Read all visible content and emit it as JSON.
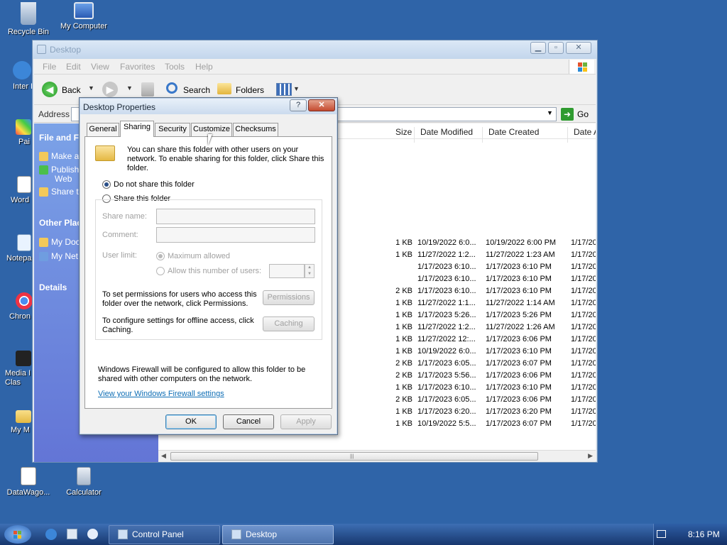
{
  "desktop": {
    "icons": [
      {
        "label": "Recycle Bin"
      },
      {
        "label": "My Computer"
      },
      {
        "label": "Inter Explo"
      },
      {
        "label": "Pai"
      },
      {
        "label": "Word"
      },
      {
        "label": "Notepa"
      },
      {
        "label": "Chron"
      },
      {
        "label": "Media I Clas"
      },
      {
        "label": "My M"
      },
      {
        "label": "DataWago..."
      },
      {
        "label": "Calculator"
      }
    ]
  },
  "explorer": {
    "title": "Desktop",
    "menu": [
      "File",
      "Edit",
      "View",
      "Favorites",
      "Tools",
      "Help"
    ],
    "toolbar": {
      "back": "Back",
      "search": "Search",
      "folders": "Folders"
    },
    "address": {
      "label": "Address",
      "go": "Go"
    },
    "taskpane": {
      "file_tasks_head": "File and Fo",
      "file_tasks": [
        "Make a",
        "Publish Web",
        "Share t"
      ],
      "other_places_head": "Other Place",
      "other_places": [
        "My Doc",
        "My Net"
      ],
      "details_head": "Details"
    },
    "columns": [
      "Size",
      "Date Modified",
      "Date Created",
      "Date A"
    ],
    "rows": [
      {
        "size": "1 KB",
        "modified": "10/19/2022 6:0...",
        "created": "10/19/2022 6:00 PM",
        "accessed": "1/17/20"
      },
      {
        "size": "1 KB",
        "modified": "11/27/2022 1:2...",
        "created": "11/27/2022 1:23 AM",
        "accessed": "1/17/20"
      },
      {
        "size": "",
        "modified": "1/17/2023 6:10...",
        "created": "1/17/2023 6:10 PM",
        "accessed": "1/17/20"
      },
      {
        "size": "",
        "modified": "1/17/2023 6:10...",
        "created": "1/17/2023 6:10 PM",
        "accessed": "1/17/20"
      },
      {
        "size": "2 KB",
        "modified": "1/17/2023 6:10...",
        "created": "1/17/2023 6:10 PM",
        "accessed": "1/17/20"
      },
      {
        "size": "1 KB",
        "modified": "11/27/2022 1:1...",
        "created": "11/27/2022 1:14 AM",
        "accessed": "1/17/20"
      },
      {
        "size": "1 KB",
        "modified": "1/17/2023 5:26...",
        "created": "1/17/2023 5:26 PM",
        "accessed": "1/17/20"
      },
      {
        "size": "1 KB",
        "modified": "11/27/2022 1:2...",
        "created": "11/27/2022 1:26 AM",
        "accessed": "1/17/20"
      },
      {
        "size": "1 KB",
        "modified": "11/27/2022 12:...",
        "created": "1/17/2023 6:06 PM",
        "accessed": "1/17/20"
      },
      {
        "size": "1 KB",
        "modified": "10/19/2022 6:0...",
        "created": "1/17/2023 6:10 PM",
        "accessed": "1/17/20"
      },
      {
        "size": "2 KB",
        "modified": "1/17/2023 6:05...",
        "created": "1/17/2023 6:07 PM",
        "accessed": "1/17/20"
      },
      {
        "size": "2 KB",
        "modified": "1/17/2023 5:56...",
        "created": "1/17/2023 6:06 PM",
        "accessed": "1/17/20"
      },
      {
        "size": "1 KB",
        "modified": "1/17/2023 6:10...",
        "created": "1/17/2023 6:10 PM",
        "accessed": "1/17/20"
      },
      {
        "size": "2 KB",
        "modified": "1/17/2023 6:05...",
        "created": "1/17/2023 6:06 PM",
        "accessed": "1/17/20"
      },
      {
        "size": "1 KB",
        "modified": "1/17/2023 6:20...",
        "created": "1/17/2023 6:20 PM",
        "accessed": "1/17/20"
      },
      {
        "size": "1 KB",
        "modified": "10/19/2022 5:5...",
        "created": "1/17/2023 6:07 PM",
        "accessed": "1/17/20"
      }
    ]
  },
  "dialog": {
    "title": "Desktop Properties",
    "help_btn": "?",
    "tabs": [
      "General",
      "Sharing",
      "Security",
      "Customize",
      "Checksums"
    ],
    "intro": "You can share this folder with other users on your network.  To enable sharing for this folder, click Share this folder.",
    "radio_no_share": "Do not share this folder",
    "radio_share": "Share this folder",
    "share_name_label": "Share name:",
    "share_name_value": "",
    "comment_label": "Comment:",
    "comment_value": "",
    "user_limit_label": "User limit:",
    "max_allowed": "Maximum allowed",
    "allow_number": "Allow this number of users:",
    "user_count_value": "",
    "permissions_text": "To set permissions for users who access this folder over the network, click Permissions.",
    "permissions_btn": "Permissions",
    "caching_text": "To configure settings for offline access, click Caching.",
    "caching_btn": "Caching",
    "firewall_text": "Windows Firewall will be configured to allow this folder to be shared with other computers on the network.",
    "firewall_link": "View your Windows Firewall settings",
    "ok": "OK",
    "cancel": "Cancel",
    "apply": "Apply"
  },
  "taskbar": {
    "buttons": [
      "Control Panel",
      "Desktop"
    ],
    "clock": "8:16 PM"
  }
}
